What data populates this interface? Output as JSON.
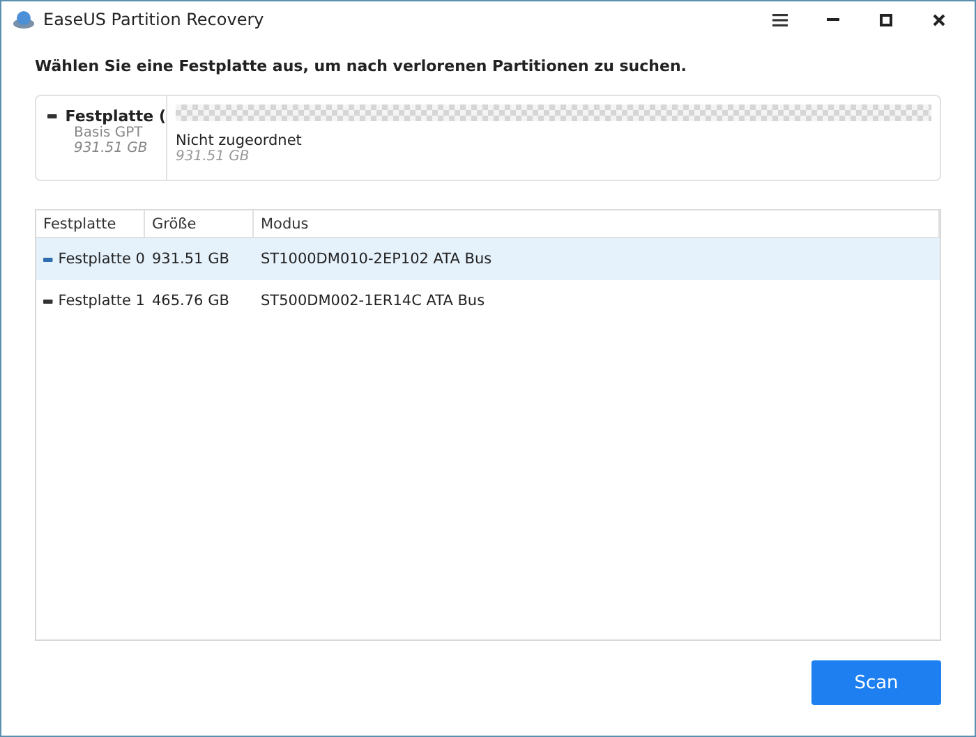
{
  "window": {
    "title": "EaseUS Partition Recovery"
  },
  "heading": "Wählen Sie eine Festplatte aus, um nach verlorenen Partitionen zu suchen.",
  "disk_map": {
    "disk": {
      "name": "Festplatte (",
      "type": "Basis GPT",
      "size": "931.51 GB"
    },
    "partition": {
      "label": "Nicht zugeordnet",
      "size": "931.51 GB"
    }
  },
  "table": {
    "columns": [
      "Festplatte",
      "Größe",
      "Modus"
    ],
    "rows": [
      {
        "disk": "Festplatte 0",
        "size": "931.51 GB",
        "model": "ST1000DM010-2EP102 ATA Bus",
        "selected": true
      },
      {
        "disk": "Festplatte 1",
        "size": "465.76 GB",
        "model": "ST500DM002-1ER14C ATA Bus",
        "selected": false
      }
    ]
  },
  "buttons": [
    {
      "label": "Scan"
    }
  ]
}
